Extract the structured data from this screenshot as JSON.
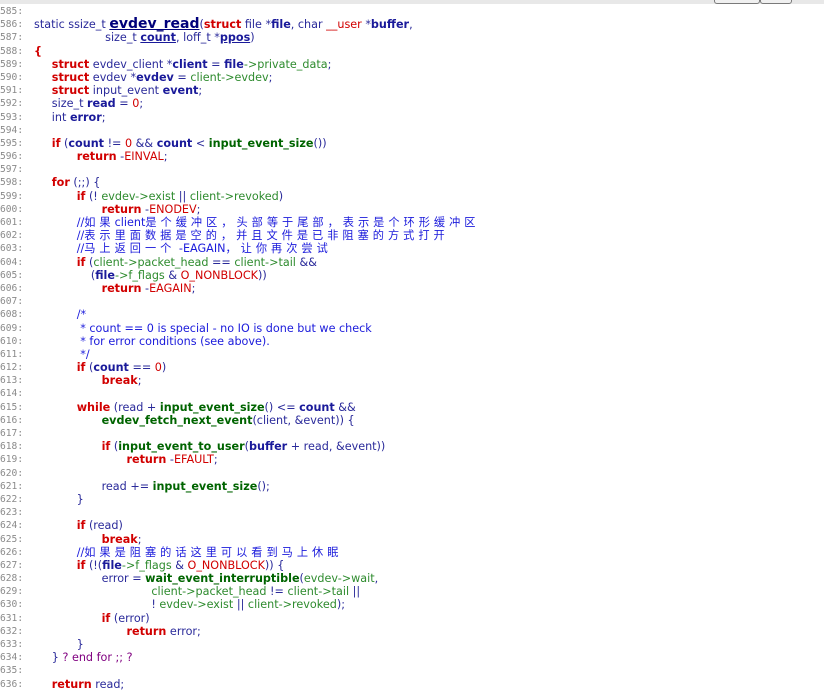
{
  "editor": {
    "lines": [
      {
        "n": "585:",
        "tokens": []
      },
      {
        "n": "586:",
        "tokens": [
          [
            "plain",
            "static ssize_t "
          ],
          [
            "fnbig",
            "evdev_read"
          ],
          [
            "op",
            "("
          ],
          [
            "kw",
            "struct"
          ],
          [
            "type",
            " file "
          ],
          [
            "op",
            "*"
          ],
          [
            "id",
            "file"
          ],
          [
            "op",
            ", char "
          ],
          [
            "macro",
            "__user"
          ],
          [
            "op",
            " *"
          ],
          [
            "id",
            "buffer"
          ],
          [
            "op",
            ","
          ]
        ]
      },
      {
        "n": "587:",
        "tokens": [
          [
            "plain",
            "                    size_t "
          ],
          [
            "idu",
            "count"
          ],
          [
            "op",
            ", loff_t *"
          ],
          [
            "idu",
            "ppos"
          ],
          [
            "op",
            ")"
          ]
        ]
      },
      {
        "n": "588:",
        "tokens": [
          [
            "kw",
            "{"
          ]
        ]
      },
      {
        "n": "589:",
        "tokens": [
          [
            "plain",
            "     "
          ],
          [
            "kw",
            "struct"
          ],
          [
            "type",
            " evdev_client "
          ],
          [
            "op",
            "*"
          ],
          [
            "id",
            "client"
          ],
          [
            "op",
            " = "
          ],
          [
            "id",
            "file"
          ],
          [
            "field",
            "->private_data"
          ],
          [
            "op",
            ";"
          ]
        ]
      },
      {
        "n": "590:",
        "tokens": [
          [
            "plain",
            "     "
          ],
          [
            "kw",
            "struct"
          ],
          [
            "type",
            " evdev "
          ],
          [
            "op",
            "*"
          ],
          [
            "id",
            "evdev"
          ],
          [
            "op",
            " = "
          ],
          [
            "field",
            "client->evdev"
          ],
          [
            "op",
            ";"
          ]
        ]
      },
      {
        "n": "591:",
        "tokens": [
          [
            "plain",
            "     "
          ],
          [
            "kw",
            "struct"
          ],
          [
            "type",
            " input_event "
          ],
          [
            "id",
            "event"
          ],
          [
            "op",
            ";"
          ]
        ]
      },
      {
        "n": "592:",
        "tokens": [
          [
            "plain",
            "     size_t "
          ],
          [
            "id",
            "read"
          ],
          [
            "op",
            " = "
          ],
          [
            "num",
            "0"
          ],
          [
            "op",
            ";"
          ]
        ]
      },
      {
        "n": "593:",
        "tokens": [
          [
            "plain",
            "     int "
          ],
          [
            "id",
            "error"
          ],
          [
            "op",
            ";"
          ]
        ]
      },
      {
        "n": "594:",
        "tokens": []
      },
      {
        "n": "595:",
        "tokens": [
          [
            "plain",
            "     "
          ],
          [
            "kw",
            "if"
          ],
          [
            "op",
            " ("
          ],
          [
            "id",
            "count"
          ],
          [
            "op",
            " != "
          ],
          [
            "num",
            "0"
          ],
          [
            "op",
            " && "
          ],
          [
            "id",
            "count"
          ],
          [
            "op",
            " < "
          ],
          [
            "fn",
            "input_event_size"
          ],
          [
            "op",
            "())"
          ]
        ]
      },
      {
        "n": "596:",
        "tokens": [
          [
            "plain",
            "            "
          ],
          [
            "kw",
            "return"
          ],
          [
            "op",
            " -"
          ],
          [
            "macro",
            "EINVAL"
          ],
          [
            "op",
            ";"
          ]
        ]
      },
      {
        "n": "597:",
        "tokens": []
      },
      {
        "n": "598:",
        "tokens": [
          [
            "plain",
            "     "
          ],
          [
            "kw",
            "for"
          ],
          [
            "op",
            " (;;) {"
          ]
        ]
      },
      {
        "n": "599:",
        "tokens": [
          [
            "plain",
            "            "
          ],
          [
            "kw",
            "if"
          ],
          [
            "op",
            " (! "
          ],
          [
            "field",
            "evdev->exist"
          ],
          [
            "op",
            " || "
          ],
          [
            "field",
            "client->revoked"
          ],
          [
            "op",
            ")"
          ]
        ]
      },
      {
        "n": "600:",
        "tokens": [
          [
            "plain",
            "                   "
          ],
          [
            "kw",
            "return"
          ],
          [
            "op",
            " -"
          ],
          [
            "macro",
            "ENODEV"
          ],
          [
            "op",
            ";"
          ]
        ]
      },
      {
        "n": "601:",
        "tokens": [
          [
            "plain",
            "            "
          ],
          [
            "comment",
            "//"
          ],
          [
            "cn",
            "如果"
          ],
          [
            "comment",
            "client"
          ],
          [
            "cn",
            "是个缓冲区，头部等于尾部，表示是个环形缓冲区"
          ]
        ]
      },
      {
        "n": "602:",
        "tokens": [
          [
            "plain",
            "            "
          ],
          [
            "comment",
            "//"
          ],
          [
            "cn",
            "表示里面数据是空的，并且文件是已非阻塞的方式打开"
          ]
        ]
      },
      {
        "n": "603:",
        "tokens": [
          [
            "plain",
            "            "
          ],
          [
            "comment",
            "//"
          ],
          [
            "cn",
            "马上返回一个"
          ],
          [
            "comment",
            " -EAGAIN"
          ],
          [
            "cn",
            "，让你再次尝试"
          ]
        ]
      },
      {
        "n": "604:",
        "tokens": [
          [
            "plain",
            "            "
          ],
          [
            "kw",
            "if"
          ],
          [
            "op",
            " ("
          ],
          [
            "field",
            "client->packet_head"
          ],
          [
            "op",
            " == "
          ],
          [
            "field",
            "client->tail"
          ],
          [
            "op",
            " &&"
          ]
        ]
      },
      {
        "n": "605:",
        "tokens": [
          [
            "plain",
            "                ("
          ],
          [
            "id",
            "file"
          ],
          [
            "field",
            "->f_flags"
          ],
          [
            "op",
            " & "
          ],
          [
            "macro",
            "O_NONBLOCK"
          ],
          [
            "op",
            "))"
          ]
        ]
      },
      {
        "n": "606:",
        "tokens": [
          [
            "plain",
            "                   "
          ],
          [
            "kw",
            "return"
          ],
          [
            "op",
            " -"
          ],
          [
            "macro",
            "EAGAIN"
          ],
          [
            "op",
            ";"
          ]
        ]
      },
      {
        "n": "607:",
        "tokens": []
      },
      {
        "n": "608:",
        "tokens": [
          [
            "plain",
            "            "
          ],
          [
            "comment",
            "/*"
          ]
        ]
      },
      {
        "n": "609:",
        "tokens": [
          [
            "plain",
            "             "
          ],
          [
            "comment",
            "* count == 0 is special - no IO is done but we check"
          ]
        ]
      },
      {
        "n": "610:",
        "tokens": [
          [
            "plain",
            "             "
          ],
          [
            "comment",
            "* for error conditions (see above)."
          ]
        ]
      },
      {
        "n": "611:",
        "tokens": [
          [
            "plain",
            "             "
          ],
          [
            "comment",
            "*/"
          ]
        ]
      },
      {
        "n": "612:",
        "tokens": [
          [
            "plain",
            "            "
          ],
          [
            "kw",
            "if"
          ],
          [
            "op",
            " ("
          ],
          [
            "id",
            "count"
          ],
          [
            "op",
            " == "
          ],
          [
            "num",
            "0"
          ],
          [
            "op",
            ")"
          ]
        ]
      },
      {
        "n": "613:",
        "tokens": [
          [
            "plain",
            "                   "
          ],
          [
            "kw",
            "break"
          ],
          [
            "op",
            ";"
          ]
        ]
      },
      {
        "n": "614:",
        "tokens": []
      },
      {
        "n": "615:",
        "tokens": [
          [
            "plain",
            "            "
          ],
          [
            "kw",
            "while"
          ],
          [
            "op",
            " (read + "
          ],
          [
            "fn",
            "input_event_size"
          ],
          [
            "op",
            "() <= "
          ],
          [
            "id",
            "count"
          ],
          [
            "op",
            " &&"
          ]
        ]
      },
      {
        "n": "616:",
        "tokens": [
          [
            "plain",
            "                   "
          ],
          [
            "fn",
            "evdev_fetch_next_event"
          ],
          [
            "op",
            "(client, &event)) {"
          ]
        ]
      },
      {
        "n": "617:",
        "tokens": []
      },
      {
        "n": "618:",
        "tokens": [
          [
            "plain",
            "                   "
          ],
          [
            "kw",
            "if"
          ],
          [
            "op",
            " ("
          ],
          [
            "fn",
            "input_event_to_user"
          ],
          [
            "op",
            "("
          ],
          [
            "id",
            "buffer"
          ],
          [
            "op",
            " + read, &event))"
          ]
        ]
      },
      {
        "n": "619:",
        "tokens": [
          [
            "plain",
            "                          "
          ],
          [
            "kw",
            "return"
          ],
          [
            "op",
            " -"
          ],
          [
            "macro",
            "EFAULT"
          ],
          [
            "op",
            ";"
          ]
        ]
      },
      {
        "n": "620:",
        "tokens": []
      },
      {
        "n": "621:",
        "tokens": [
          [
            "plain",
            "                   read += "
          ],
          [
            "fn",
            "input_event_size"
          ],
          [
            "op",
            "();"
          ]
        ]
      },
      {
        "n": "622:",
        "tokens": [
          [
            "plain",
            "            }"
          ]
        ]
      },
      {
        "n": "623:",
        "tokens": []
      },
      {
        "n": "624:",
        "tokens": [
          [
            "plain",
            "            "
          ],
          [
            "kw",
            "if"
          ],
          [
            "op",
            " (read)"
          ]
        ]
      },
      {
        "n": "625:",
        "tokens": [
          [
            "plain",
            "                   "
          ],
          [
            "kw",
            "break"
          ],
          [
            "op",
            ";"
          ]
        ]
      },
      {
        "n": "626:",
        "tokens": [
          [
            "plain",
            "            "
          ],
          [
            "comment",
            "//"
          ],
          [
            "cn",
            "如果是阻塞的话这里可以看到马上休眠"
          ]
        ]
      },
      {
        "n": "627:",
        "tokens": [
          [
            "plain",
            "            "
          ],
          [
            "kw",
            "if"
          ],
          [
            "op",
            " (!("
          ],
          [
            "id",
            "file"
          ],
          [
            "field",
            "->f_flags"
          ],
          [
            "op",
            " & "
          ],
          [
            "macro",
            "O_NONBLOCK"
          ],
          [
            "op",
            ")) {"
          ]
        ]
      },
      {
        "n": "628:",
        "tokens": [
          [
            "plain",
            "                   error = "
          ],
          [
            "fn",
            "wait_event_interruptible"
          ],
          [
            "op",
            "("
          ],
          [
            "field",
            "evdev->wait"
          ],
          [
            "op",
            ","
          ]
        ]
      },
      {
        "n": "629:",
        "tokens": [
          [
            "plain",
            "                                 "
          ],
          [
            "field",
            "client->packet_head"
          ],
          [
            "op",
            " != "
          ],
          [
            "field",
            "client->tail"
          ],
          [
            "op",
            " ||"
          ]
        ]
      },
      {
        "n": "630:",
        "tokens": [
          [
            "plain",
            "                                 ! "
          ],
          [
            "field",
            "evdev->exist"
          ],
          [
            "op",
            " || "
          ],
          [
            "field",
            "client->revoked"
          ],
          [
            "op",
            ");"
          ]
        ]
      },
      {
        "n": "631:",
        "tokens": [
          [
            "plain",
            "                   "
          ],
          [
            "kw",
            "if"
          ],
          [
            "op",
            " (error)"
          ]
        ]
      },
      {
        "n": "632:",
        "tokens": [
          [
            "plain",
            "                          "
          ],
          [
            "kw",
            "return"
          ],
          [
            "op",
            " error;"
          ]
        ]
      },
      {
        "n": "633:",
        "tokens": [
          [
            "plain",
            "            }"
          ]
        ]
      },
      {
        "n": "634:",
        "tokens": [
          [
            "plain",
            "     } "
          ],
          [
            "purple",
            "? end for ;; ?"
          ]
        ]
      },
      {
        "n": "635:",
        "tokens": []
      },
      {
        "n": "636:",
        "tokens": [
          [
            "plain",
            "     "
          ],
          [
            "kw",
            "return"
          ],
          [
            "op",
            " read;"
          ]
        ]
      }
    ]
  }
}
